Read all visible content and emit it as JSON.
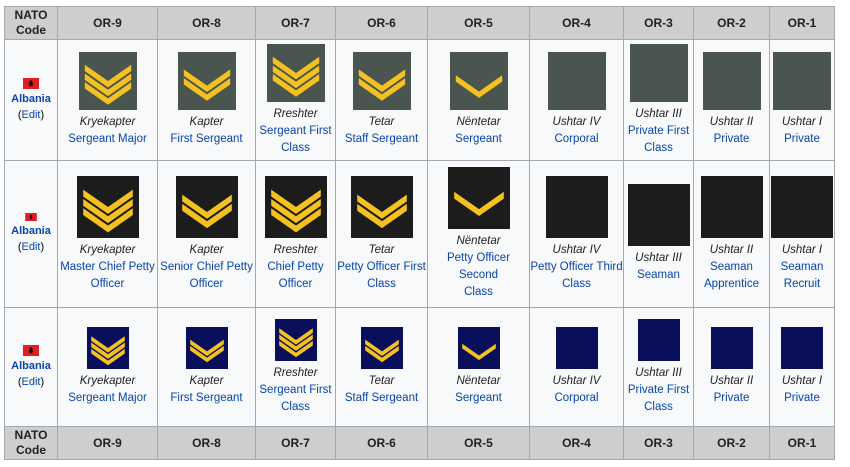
{
  "header": {
    "nato_label_line1": "NATO",
    "nato_label_line2": "Code",
    "codes": [
      "OR-9",
      "OR-8",
      "OR-7",
      "OR-6",
      "OR-5",
      "OR-4",
      "OR-3",
      "OR-2",
      "OR-1"
    ]
  },
  "colors": {
    "army_bg": "#4a554f",
    "navy_bg": "#1c1c1c",
    "air_bg": "#0a0f5c",
    "chevron": "#f4c121",
    "link": "#0645ad",
    "header_bg": "#cecece"
  },
  "rows": [
    {
      "country": "Albania",
      "edit": "Edit",
      "style": "army",
      "ranks": [
        {
          "native": "Kryekapter",
          "english_line1": "Sergeant Major",
          "english_line2": "",
          "chevrons": 3
        },
        {
          "native": "Kapter",
          "english_line1": "First Sergeant",
          "english_line2": "",
          "chevrons": 2
        },
        {
          "native": "Rreshter",
          "english_line1": "Sergeant First",
          "english_line2": "Class",
          "chevrons": 3
        },
        {
          "native": "Tetar",
          "english_line1": "Staff Sergeant",
          "english_line2": "",
          "chevrons": 2
        },
        {
          "native": "Nëntetar",
          "english_line1": "Sergeant",
          "english_line2": "",
          "chevrons": 1
        },
        {
          "native": "Ushtar IV",
          "english_line1": "Corporal",
          "english_line2": "",
          "chevrons": 0
        },
        {
          "native": "Ushtar III",
          "english_line1": "Private First",
          "english_line2": "Class",
          "chevrons": 0
        },
        {
          "native": "Ushtar II",
          "english_line1": "Private",
          "english_line2": "",
          "chevrons": 0
        },
        {
          "native": "Ushtar I",
          "english_line1": "Private",
          "english_line2": "",
          "chevrons": 0
        }
      ]
    },
    {
      "country": "Albania",
      "edit": "Edit",
      "style": "navy",
      "ranks": [
        {
          "native": "Kryekapter",
          "english_line1": "Master Chief Petty",
          "english_line2": "Officer",
          "chevrons": 3
        },
        {
          "native": "Kapter",
          "english_line1": "Senior Chief Petty",
          "english_line2": "Officer",
          "chevrons": 2
        },
        {
          "native": "Rreshter",
          "english_line1": "Chief Petty",
          "english_line2": "Officer",
          "chevrons": 3
        },
        {
          "native": "Tetar",
          "english_line1": "Petty Officer First",
          "english_line2": "Class",
          "chevrons": 2
        },
        {
          "native": "Nëntetar",
          "english_line1": "Petty Officer Second",
          "english_line2": "Class",
          "chevrons": 1
        },
        {
          "native": "Ushtar IV",
          "english_line1": "Petty Officer Third",
          "english_line2": "Class",
          "chevrons": 0
        },
        {
          "native": "Ushtar III",
          "english_line1": "Seaman",
          "english_line2": "",
          "chevrons": 0
        },
        {
          "native": "Ushtar II",
          "english_line1": "Seaman",
          "english_line2": "Apprentice",
          "chevrons": 0
        },
        {
          "native": "Ushtar I",
          "english_line1": "Seaman",
          "english_line2": "Recruit",
          "chevrons": 0
        }
      ]
    },
    {
      "country": "Albania",
      "edit": "Edit",
      "style": "air",
      "ranks": [
        {
          "native": "Kryekapter",
          "english_line1": "Sergeant Major",
          "english_line2": "",
          "chevrons": 3
        },
        {
          "native": "Kapter",
          "english_line1": "First Sergeant",
          "english_line2": "",
          "chevrons": 2
        },
        {
          "native": "Rreshter",
          "english_line1": "Sergeant First",
          "english_line2": "Class",
          "chevrons": 3
        },
        {
          "native": "Tetar",
          "english_line1": "Staff Sergeant",
          "english_line2": "",
          "chevrons": 2
        },
        {
          "native": "Nëntetar",
          "english_line1": "Sergeant",
          "english_line2": "",
          "chevrons": 1
        },
        {
          "native": "Ushtar IV",
          "english_line1": "Corporal",
          "english_line2": "",
          "chevrons": 0
        },
        {
          "native": "Ushtar III",
          "english_line1": "Private First",
          "english_line2": "Class",
          "chevrons": 0
        },
        {
          "native": "Ushtar II",
          "english_line1": "Private",
          "english_line2": "",
          "chevrons": 0
        },
        {
          "native": "Ushtar I",
          "english_line1": "Private",
          "english_line2": "",
          "chevrons": 0
        }
      ]
    }
  ]
}
